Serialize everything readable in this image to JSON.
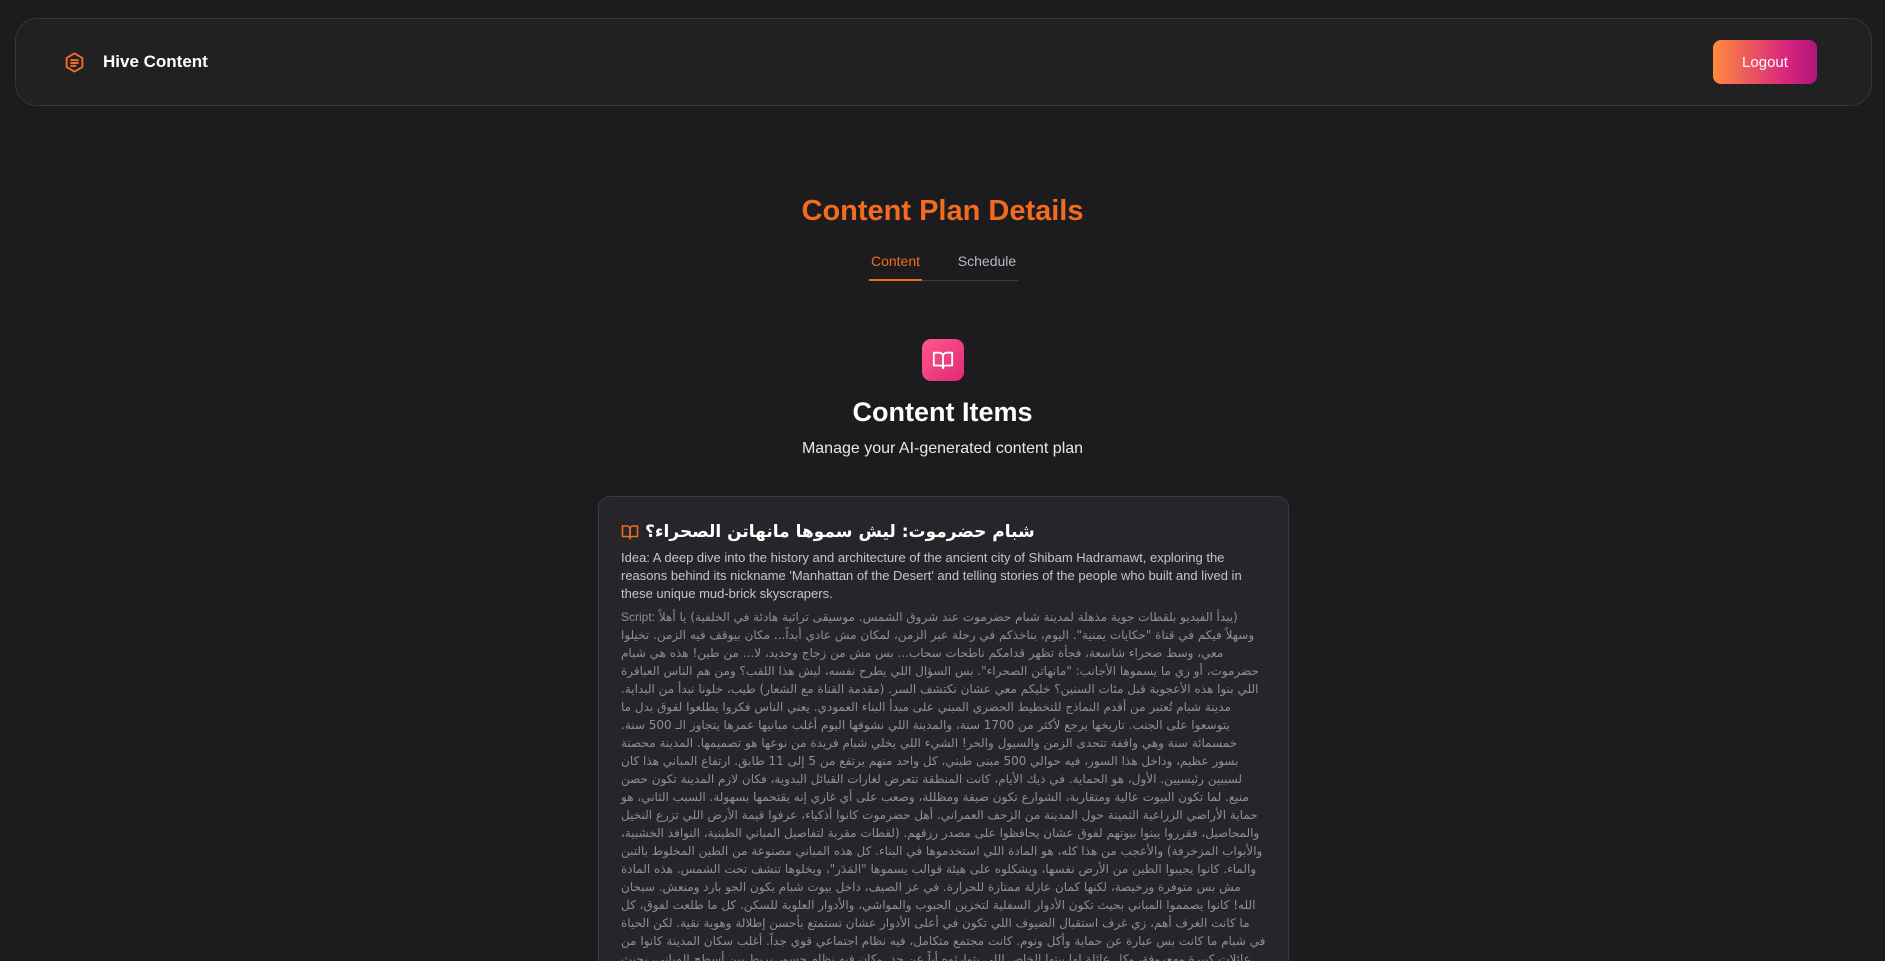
{
  "nav": {
    "brand_name": "Hive Content",
    "brand_icon": "document-list-icon",
    "logout_label": "Logout"
  },
  "page": {
    "title": "Content Plan Details",
    "tabs": [
      {
        "label": "Content",
        "active": true
      },
      {
        "label": "Schedule",
        "active": false
      }
    ]
  },
  "section": {
    "icon": "open-book-icon",
    "title": "Content Items",
    "subtitle": "Manage your AI-generated content plan"
  },
  "content_items": [
    {
      "title": "شبام حضرموت: ليش سموها مانهاتن الصحراء؟",
      "idea": "Idea: A deep dive into the history and architecture of the ancient city of Shibam Hadramawt, exploring the reasons behind its nickname 'Manhattan of the Desert' and telling stories of the people who built and lived in these unique mud-brick skyscrapers.",
      "script_label": "Script:",
      "script": "(يبدأ الفيديو بلقطات جوية مذهلة لمدينة شبام حضرموت عند شروق الشمس. موسيقى تراثية هادئة في الخلفية) يا أهلاً وسهلاً فيكم في قناة \"حكايات يمنية\". اليوم، بناخذكم في رحلة عبر الزمن، لمكان مش عادي أبداً... مكان بيوقف فيه الزمن. تخيلوا معي، وسط صحراء شاسعة، فجأة تظهر قدامكم ناطحات سحاب... بس مش من زجاج وحديد، لا... من طين! هذه هي شبام حضرموت، أو زي ما يسموها الأجانب: \"مانهاتن الصحراء\". بس السؤال اللي يطرح نفسه، ليش هذا اللقب؟ ومن هم الناس العباقرة اللي بنوا هذه الأعجوبة قبل مئات السنين؟ خليكم معي عشان نكتشف السر. (مقدمة القناة مع الشعار) طيب، خلونا نبدأ من البداية. مدينة شبام تُعتبر من أقدم النماذج للتخطيط الحضري المبني على مبدأ البناء العمودي. يعني الناس فكروا يطلعوا لفوق بدل ما يتوسعوا على الجنب. تاريخها يرجع لأكثر من 1700 سنة، والمدينة اللي نشوفها اليوم أغلب مبانيها عمرها يتجاوز الـ 500 سنة. خمسمائة سنة وهي واقفة تتحدى الزمن والسيول والحر! الشيء اللي يخلي شبام فريدة من نوعها هو تصميمها. المدينة محصنة بسور عظيم، وداخل هذا السور، فيه حوالي 500 مبنى طيني، كل واحد منهم يرتفع من 5 إلى 11 طابق. ارتفاع المباني هذا كان لسببين رئيسيين. الأول، هو الحماية. في ذيك الأيام، كانت المنطقة تتعرض لغارات القبائل البدوية، فكان لازم المدينة تكون حصن منيع. لما تكون البيوت عالية ومتقاربة، الشوارع تكون ضيقة ومظللة، وصعب على أي غازي إنه يقتحمها بسهولة. السبب الثاني، هو حماية الأراضي الزراعية الثمينة حول المدينة من الزحف العمراني. أهل حضرموت كانوا أذكياء، عرفوا قيمة الأرض اللي تزرع النخيل والمحاصيل، فقرروا يبنوا بيوتهم لفوق عشان يحافظوا على مصدر رزقهم. (لقطات مقربة لتفاصيل المباني الطينية، النوافذ الخشبية، والأبواب المزخرفة) والأعجب من هذا كله، هو المادة اللي استخدموها في البناء. كل هذه المباني مصنوعة من الطين المخلوط بالتبن والماء. كانوا يجيبوا الطين من الأرض نفسها، ويشكلوه على هيئة قوالب يسموها \"المَدَر\"، ويخلوها تنشف تحت الشمس. هذه المادة مش بس متوفرة ورخيصة، لكنها كمان عازلة ممتازة للحرارة. في عز الصيف، داخل بيوت شبام يكون الجو بارد ومنعش. سبحان الله! كانوا يصمموا المباني بحيث تكون الأدوار السفلية لتخزين الحبوب والمواشي، والأدوار العلوية للسكن. كل ما طلعت لفوق، كل ما كانت الغرف أهم، زي غرف استقبال الضيوف اللي تكون في أعلى الأدوار عشان تستمتع بأحسن إطلالة وهوية نقية. لكن الحياة في شبام ما كانت بس عبارة عن حماية وأكل ونوم. كانت مجتمع متكامل، فيه نظام اجتماعي قوي جداً. أغلب سكان المدينة كانوا من عائلات كبيرة ومعروفة، وكل عائلة لها بيتها الخاص اللي يتوارثوه أباً عن جد. وكان فيه نظام جسور يربط بين أسطح المباني، بحيث إن النساء والأطفال يقدروا يتنقلوا بين بيوت الجيران والأقارب بدون ما ينزلوا للشارع. هذا"
    }
  ],
  "colors": {
    "accent": "#f26b21",
    "background": "#1c1c1f",
    "card": "#26262a"
  }
}
